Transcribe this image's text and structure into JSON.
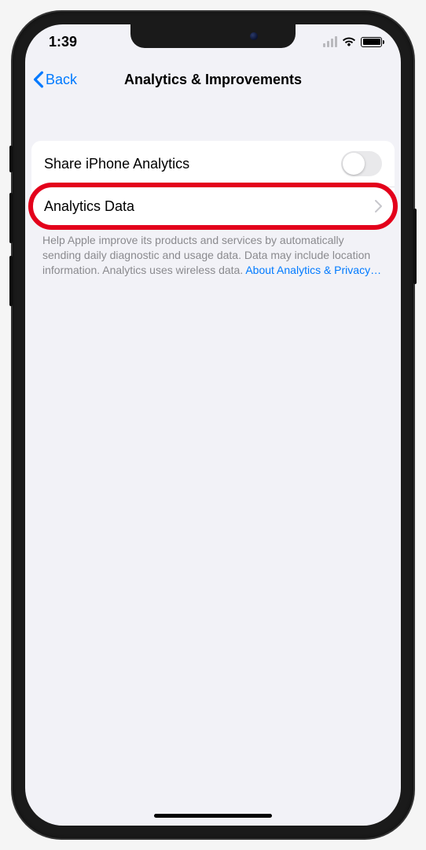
{
  "status": {
    "time": "1:39"
  },
  "nav": {
    "back_label": "Back",
    "title": "Analytics & Improvements"
  },
  "rows": {
    "share_analytics": {
      "label": "Share iPhone Analytics"
    },
    "analytics_data": {
      "label": "Analytics Data"
    }
  },
  "footer": {
    "text": "Help Apple improve its products and services by automatically sending daily diagnostic and usage data. Data may include location information. Analytics uses wireless data. ",
    "link": "About Analytics & Privacy…"
  }
}
